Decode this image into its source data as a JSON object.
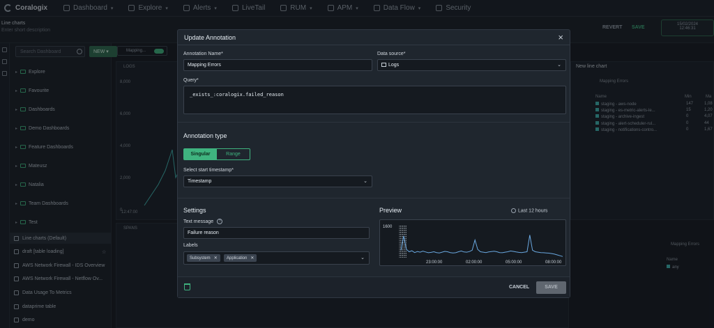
{
  "app": {
    "logo_text": "Coralogix"
  },
  "nav": {
    "items": [
      {
        "label": "Dashboard",
        "caret": true,
        "icon": "grid-icon"
      },
      {
        "label": "Explore",
        "caret": true,
        "icon": "compass-icon"
      },
      {
        "label": "Alerts",
        "caret": true,
        "icon": "bell-icon"
      },
      {
        "label": "LiveTail",
        "caret": false,
        "icon": "pulse-icon"
      },
      {
        "label": "RUM",
        "caret": true,
        "icon": "rum-icon"
      },
      {
        "label": "APM",
        "caret": true,
        "icon": "apm-icon"
      },
      {
        "label": "Data Flow",
        "caret": true,
        "icon": "flow-icon"
      },
      {
        "label": "Security",
        "caret": false,
        "icon": "shield-icon"
      }
    ]
  },
  "subheader": {
    "title": "Line charts",
    "description": "Enter short description",
    "revert_label": "REVERT",
    "save_label": "SAVE",
    "date": "15/02/2024",
    "time": "12:46:31"
  },
  "sidebar": {
    "search_placeholder": "Search Dashboard",
    "new_label": "NEW",
    "folders": [
      "Explore",
      "Favourite",
      "Dashboards",
      "Demo Dashboards",
      "Feature Dashboards",
      "Mateusz",
      "Natalia",
      "Team Dashboards",
      "Test"
    ],
    "dashboards": [
      "Line charts (Default)",
      "draft [table loading]",
      "AWS Network Firewall - IDS Overview",
      "AWS Network Firewall - Netflow Ov...",
      "Data Usage To Metrics",
      "dataprime table",
      "demo"
    ]
  },
  "background": {
    "mapping_toggle_label": "Mapping...",
    "logs_panel_label": "LOGS",
    "spans_panel_label": "SPANS",
    "right_panel_title": "New line chart",
    "legend_title": "Mapping Errors",
    "legend_header": {
      "name": "Name",
      "min": "Min",
      "max": "Ma"
    },
    "legend_rows": [
      {
        "name": "staging - aws-node",
        "min": "147",
        "max": "1,08"
      },
      {
        "name": "staging - es-metric-alerts-le...",
        "min": "15",
        "max": "1,20"
      },
      {
        "name": "staging - archive-ingest",
        "min": "0",
        "max": "4,07"
      },
      {
        "name": "staging - alert-scheduler-rul...",
        "min": "0",
        "max": "44"
      },
      {
        "name": "staging - notifications-contro...",
        "min": "0",
        "max": "1,67"
      }
    ],
    "y_ticks": [
      "8,000",
      "6,000",
      "4,000",
      "2,000",
      "0"
    ],
    "x_tick": "12:47:00",
    "legend2_title": "Mapping Errors",
    "legend2_name": "Name",
    "legend2_row": "any"
  },
  "modal": {
    "title": "Update Annotation",
    "name_label": "Annotation Name*",
    "name_value": "Mapping Errors",
    "datasource_label": "Data source*",
    "datasource_value": "Logs",
    "query_label": "Query*",
    "query_value": "_exists_:coralogix.failed_reason",
    "type_title": "Annotation type",
    "type_singular": "Singular",
    "type_range": "Range",
    "start_label": "Select start timestamp*",
    "start_value": "Timestamp",
    "settings_title": "Settings",
    "text_message_label": "Text message",
    "text_message_value": "Failure reason",
    "labels_label": "Labels",
    "labels_chips": [
      "Subsystem",
      "Application"
    ],
    "preview_title": "Preview",
    "preview_range": "Last 12 hours",
    "cancel_label": "CANCEL",
    "save_label": "SAVE"
  },
  "chart_data": {
    "type": "line",
    "title": "",
    "y_tick": "1600",
    "x_ticks": [
      "23:00:00",
      "02:00:00",
      "05:00:00",
      "08:00:00"
    ],
    "ylim": [
      0,
      1700
    ],
    "values": [
      380,
      1100,
      420,
      300,
      350,
      260,
      310,
      280,
      330,
      290,
      250,
      270,
      300,
      260,
      240,
      280,
      320,
      300,
      260,
      240,
      250,
      300,
      340,
      290,
      280,
      310,
      380,
      900,
      420,
      300,
      280,
      260,
      290,
      310,
      330,
      300,
      260,
      250,
      280,
      300,
      340,
      320,
      290,
      270,
      260,
      280,
      300,
      1150,
      380,
      300,
      280,
      260,
      250,
      240,
      230,
      210,
      180,
      140,
      100,
      60
    ]
  }
}
